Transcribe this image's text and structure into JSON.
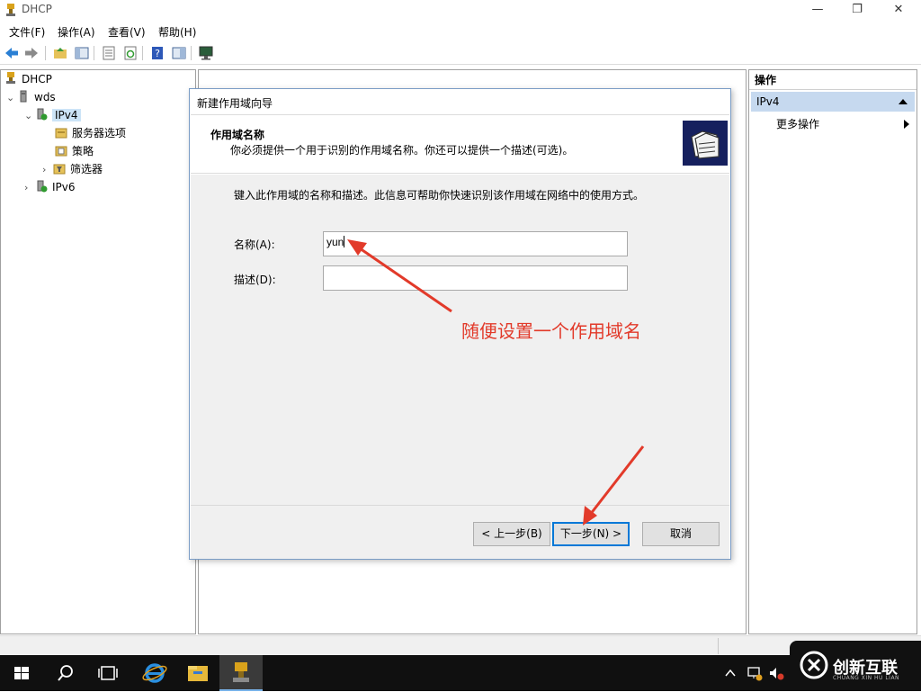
{
  "window": {
    "title": "DHCP",
    "controls": {
      "minimize": "—",
      "maximize": "❐",
      "close": "✕"
    }
  },
  "menu": [
    "文件(F)",
    "操作(A)",
    "查看(V)",
    "帮助(H)"
  ],
  "toolbar": {
    "icons": [
      "back-arrow-icon",
      "forward-arrow-icon",
      "up-folder-icon",
      "show-tree-icon",
      "properties-icon",
      "refresh-icon",
      "help-icon",
      "show-action-pane-icon",
      "monitor-icon"
    ]
  },
  "tree": {
    "root": "DHCP",
    "server": "wds",
    "ipv4": "IPv4",
    "server_options": "服务器选项",
    "policies": "策略",
    "filters": "筛选器",
    "ipv6": "IPv6"
  },
  "actions": {
    "header": "操作",
    "section": "IPv4",
    "more": "更多操作"
  },
  "dialog": {
    "title": "新建作用域向导",
    "heading": "作用域名称",
    "subheading": "你必须提供一个用于识别的作用域名称。你还可以提供一个描述(可选)。",
    "intro": "键入此作用域的名称和描述。此信息可帮助你快速识别该作用域在网络中的使用方式。",
    "name_label": "名称(A):",
    "name_value": "yun",
    "desc_label": "描述(D):",
    "desc_value": "",
    "back_button": "< 上一步(B)",
    "next_button": "下一步(N) >",
    "cancel_button": "取消"
  },
  "annotation": {
    "text": "随便设置一个作用域名",
    "color": "#e23a2a"
  },
  "watermark": {
    "text": "创新互联",
    "subtext": "CHUANG XIN HU LIAN"
  },
  "colors": {
    "selection": "#cce4f7",
    "action_highlight": "#c6d9ef",
    "accent": "#0078d7",
    "arrow": "#e23a2a",
    "taskbar": "#101010"
  }
}
